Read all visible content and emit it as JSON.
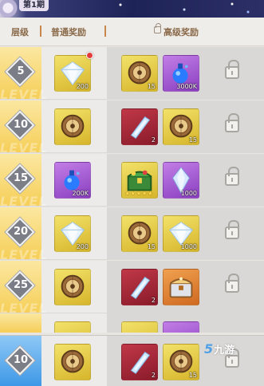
{
  "banner": {
    "period": "第1期"
  },
  "header": {
    "col_level": "层级",
    "col_normal": "普通奖励",
    "col_premium": "高级奖励"
  },
  "rows": [
    {
      "level": "5",
      "normal": {
        "icon": "diamond-icon",
        "qty": "200",
        "has_dot": true
      },
      "premium": [
        {
          "icon": "coin-icon",
          "qty": "15",
          "bg": "gold"
        },
        {
          "icon": "potion-icon",
          "qty": "3000K",
          "bg": "purple"
        }
      ]
    },
    {
      "level": "10",
      "normal": {
        "icon": "coin-icon",
        "qty": ""
      },
      "premium": [
        {
          "icon": "scroll-icon",
          "qty": "2",
          "bg": "red"
        },
        {
          "icon": "coin-icon",
          "qty": "15",
          "bg": "gold"
        }
      ]
    },
    {
      "level": "15",
      "normal": {
        "icon": "potion-icon",
        "qty": "200K",
        "bg": "purple"
      },
      "premium": [
        {
          "icon": "treasure-chest-icon",
          "qty": "",
          "bg": "gold",
          "stars": "★★★★★"
        },
        {
          "icon": "crystal-icon",
          "qty": "1000",
          "bg": "purple"
        }
      ]
    },
    {
      "level": "20",
      "normal": {
        "icon": "diamond-icon",
        "qty": "200"
      },
      "premium": [
        {
          "icon": "coin-icon",
          "qty": "15",
          "bg": "gold"
        },
        {
          "icon": "diamond-icon",
          "qty": "1000",
          "bg": "gold"
        }
      ]
    },
    {
      "level": "25",
      "normal": {
        "icon": "coin-icon",
        "qty": ""
      },
      "premium": [
        {
          "icon": "scroll-icon",
          "qty": "2",
          "bg": "red"
        },
        {
          "icon": "orange-chest-icon",
          "qty": "",
          "bg": "orange"
        }
      ]
    }
  ],
  "current": {
    "level": "10",
    "normal": {
      "icon": "coin-icon",
      "qty": ""
    },
    "premium": [
      {
        "icon": "scroll-icon",
        "qty": "2",
        "bg": "red"
      },
      {
        "icon": "coin-icon",
        "qty": "15",
        "bg": "gold"
      }
    ]
  },
  "watermark": "LEVEL",
  "logo": {
    "mark": "5",
    "text": "九游"
  },
  "colors": {
    "gold_tile": "#e6c844",
    "purple_tile": "#a55fd6",
    "red_tile": "#a6283a",
    "level_yellow": "#f6cf58",
    "level_blue": "#3e98e6"
  }
}
